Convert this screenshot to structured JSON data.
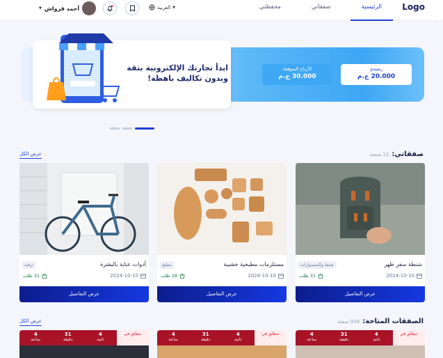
{
  "nav": {
    "logo": "Logo",
    "links": [
      {
        "label": "الرئيسية"
      },
      {
        "label": "صفقاتي"
      },
      {
        "label": "محفظتي"
      }
    ],
    "language": "العربية",
    "user_name": "أحمد قرواش"
  },
  "hero": {
    "title": "ابدأ تجارتك الإلكترونية بثقة وبدون تكاليف باهظة!",
    "balance_label": "رصيدي",
    "balance_value": "20.000 ج.م",
    "profit_label": "الأرباح المتوقعة",
    "profit_value": "30.000 ج.م"
  },
  "my_deals": {
    "title": "صفقاتي:",
    "count": "12 صفقة",
    "view_all": "عرض الكل",
    "cards": [
      {
        "name": "شنطة سفر ظهر",
        "category": "شنط وإكسسوارات",
        "date": "2024-10-10",
        "orders": "31 طلب",
        "button": "عرض التفاصيل"
      },
      {
        "name": "مستلزمات مطبخية خشبية",
        "category": "مطبخ",
        "date": "2024-10-10",
        "orders": "28 طلب",
        "button": "عرض التفاصيل"
      },
      {
        "name": "أدوات عناية بالبشرة",
        "category": "ترفيه",
        "date": "2024-10-10",
        "orders": "31 طلب",
        "button": "عرض التفاصيل"
      }
    ]
  },
  "available_deals": {
    "title": "الصفقات المتاحة:",
    "count": "938 صفقة",
    "view_all": "عرض الكل",
    "countdown": [
      {
        "label": "تنطلق في",
        "s": "4",
        "s_unit": "ثانية",
        "m": "31",
        "m_unit": "دقيقة",
        "h": "4",
        "h_unit": "ساعة"
      },
      {
        "label": "تنطلق في",
        "s": "4",
        "s_unit": "ثانية",
        "m": "31",
        "m_unit": "دقيقة",
        "h": "4",
        "h_unit": "ساعة"
      },
      {
        "label": "تنطلق في",
        "s": "4",
        "s_unit": "ثانية",
        "m": "31",
        "m_unit": "دقيقة",
        "h": "4",
        "h_unit": "ساعة"
      }
    ]
  },
  "colors": {
    "primary": "#1d3fd6",
    "dark_blue": "#0c1d8c",
    "red": "#e01e3a"
  },
  "icons": {
    "bookmark": "bookmark-icon",
    "bell": "bell-icon",
    "globe": "globe-icon",
    "calendar": "calendar-icon",
    "bag": "bag-icon"
  }
}
